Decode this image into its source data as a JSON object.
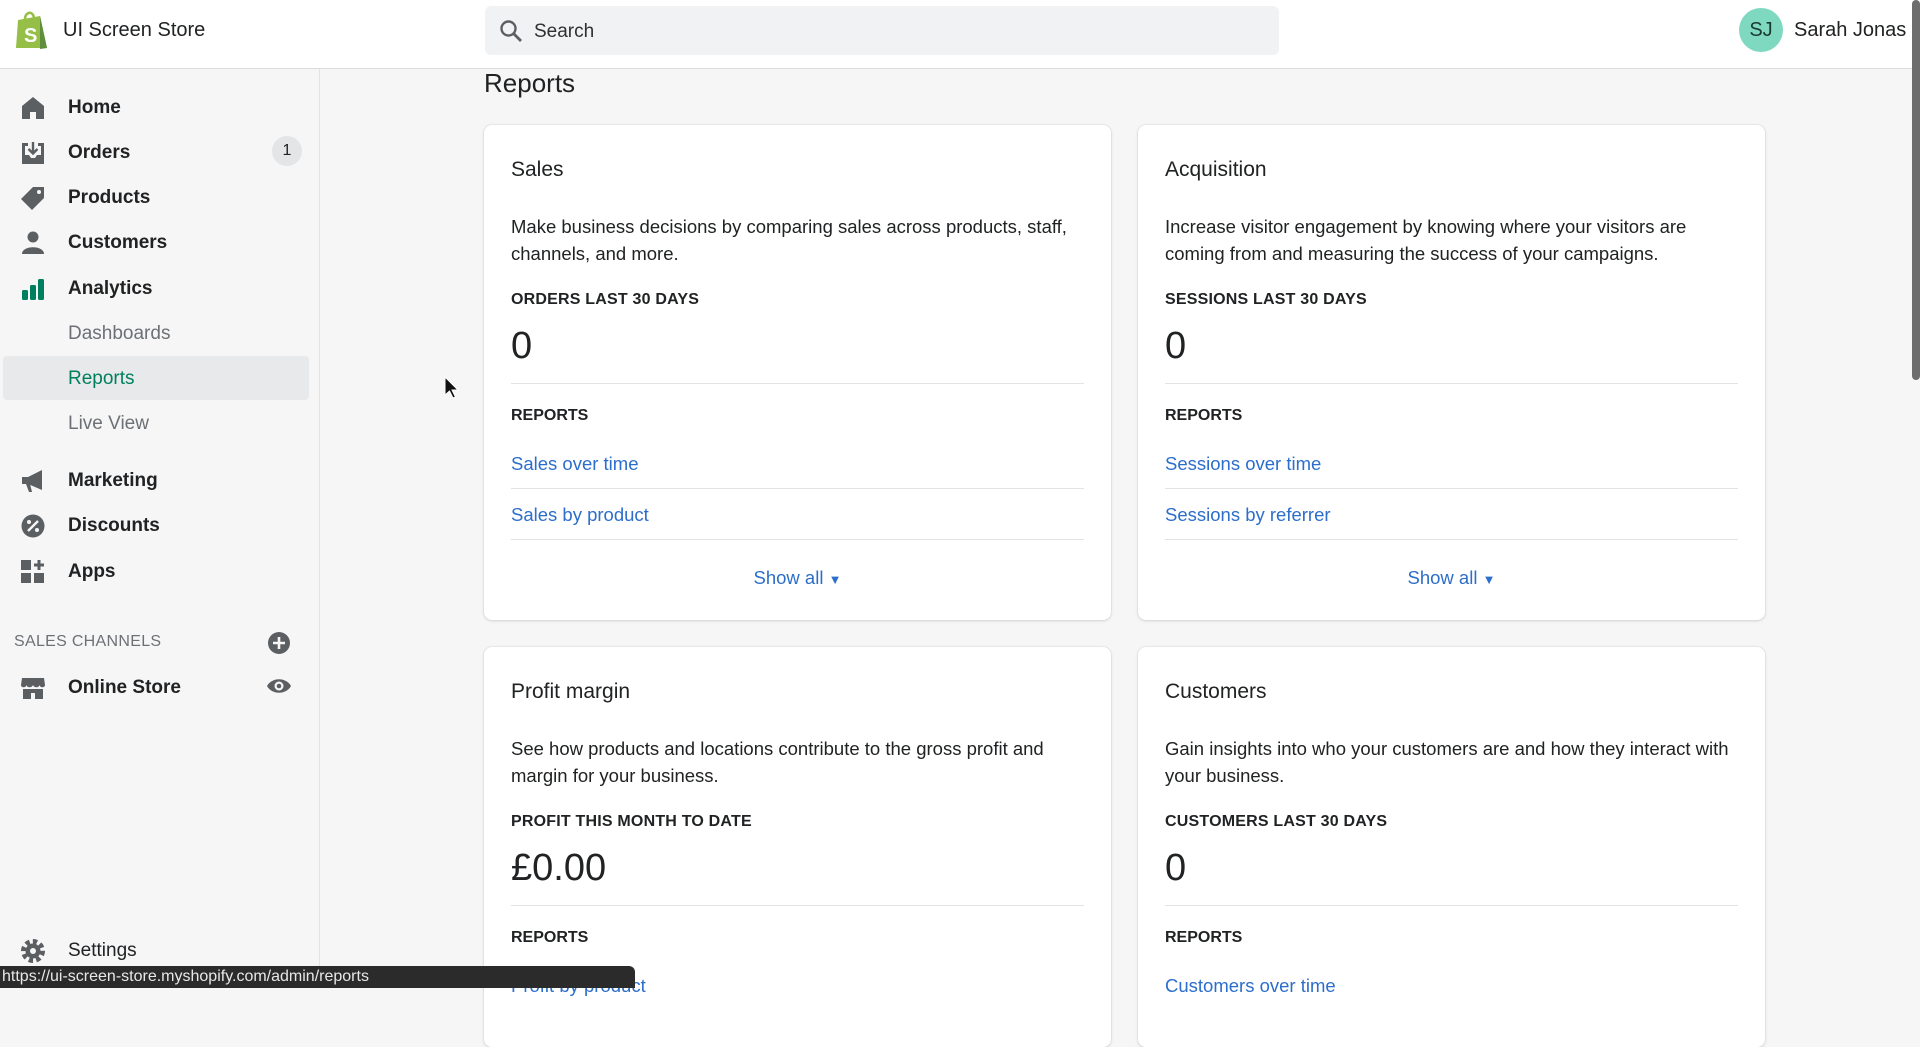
{
  "header": {
    "store_name": "UI Screen Store",
    "search_placeholder": "Search",
    "user_initials": "SJ",
    "user_name": "Sarah Jonas"
  },
  "sidebar": {
    "items": [
      {
        "label": "Home",
        "icon": "home-icon"
      },
      {
        "label": "Orders",
        "icon": "orders-icon",
        "badge": "1"
      },
      {
        "label": "Products",
        "icon": "tag-icon"
      },
      {
        "label": "Customers",
        "icon": "person-icon"
      },
      {
        "label": "Analytics",
        "icon": "bar-chart-icon"
      }
    ],
    "analytics_sub": [
      {
        "label": "Dashboards"
      },
      {
        "label": "Reports",
        "active": true
      },
      {
        "label": "Live View"
      }
    ],
    "more_items": [
      {
        "label": "Marketing",
        "icon": "megaphone-icon"
      },
      {
        "label": "Discounts",
        "icon": "discount-icon"
      },
      {
        "label": "Apps",
        "icon": "apps-icon"
      }
    ],
    "sales_channels_heading": "SALES CHANNELS",
    "online_store": "Online Store",
    "settings": "Settings"
  },
  "page": {
    "title": "Reports"
  },
  "cards": [
    {
      "title": "Sales",
      "description": "Make business decisions by comparing sales across products, staff, channels, and more.",
      "metric_label": "ORDERS LAST 30 DAYS",
      "metric_value": "0",
      "reports_label": "REPORTS",
      "links": [
        "Sales over time",
        "Sales by product"
      ],
      "show_all": "Show all"
    },
    {
      "title": "Acquisition",
      "description": "Increase visitor engagement by knowing where your visitors are coming from and measuring the success of your campaigns.",
      "metric_label": "SESSIONS LAST 30 DAYS",
      "metric_value": "0",
      "reports_label": "REPORTS",
      "links": [
        "Sessions over time",
        "Sessions by referrer"
      ],
      "show_all": "Show all"
    },
    {
      "title": "Profit margin",
      "description": "See how products and locations contribute to the gross profit and margin for your business.",
      "metric_label": "PROFIT THIS MONTH TO DATE",
      "metric_value": "£0.00",
      "reports_label": "REPORTS",
      "links": [
        "Profit by product"
      ]
    },
    {
      "title": "Customers",
      "description": "Gain insights into who your customers are and how they interact with your business.",
      "metric_label": "CUSTOMERS LAST 30 DAYS",
      "metric_value": "0",
      "reports_label": "REPORTS",
      "links": [
        "Customers over time"
      ]
    }
  ],
  "status_bar": "https://ui-screen-store.myshopify.com/admin/reports",
  "colors": {
    "accent": "#007f5f",
    "link": "#2c6ecb",
    "avatar": "#7fd9c1"
  }
}
